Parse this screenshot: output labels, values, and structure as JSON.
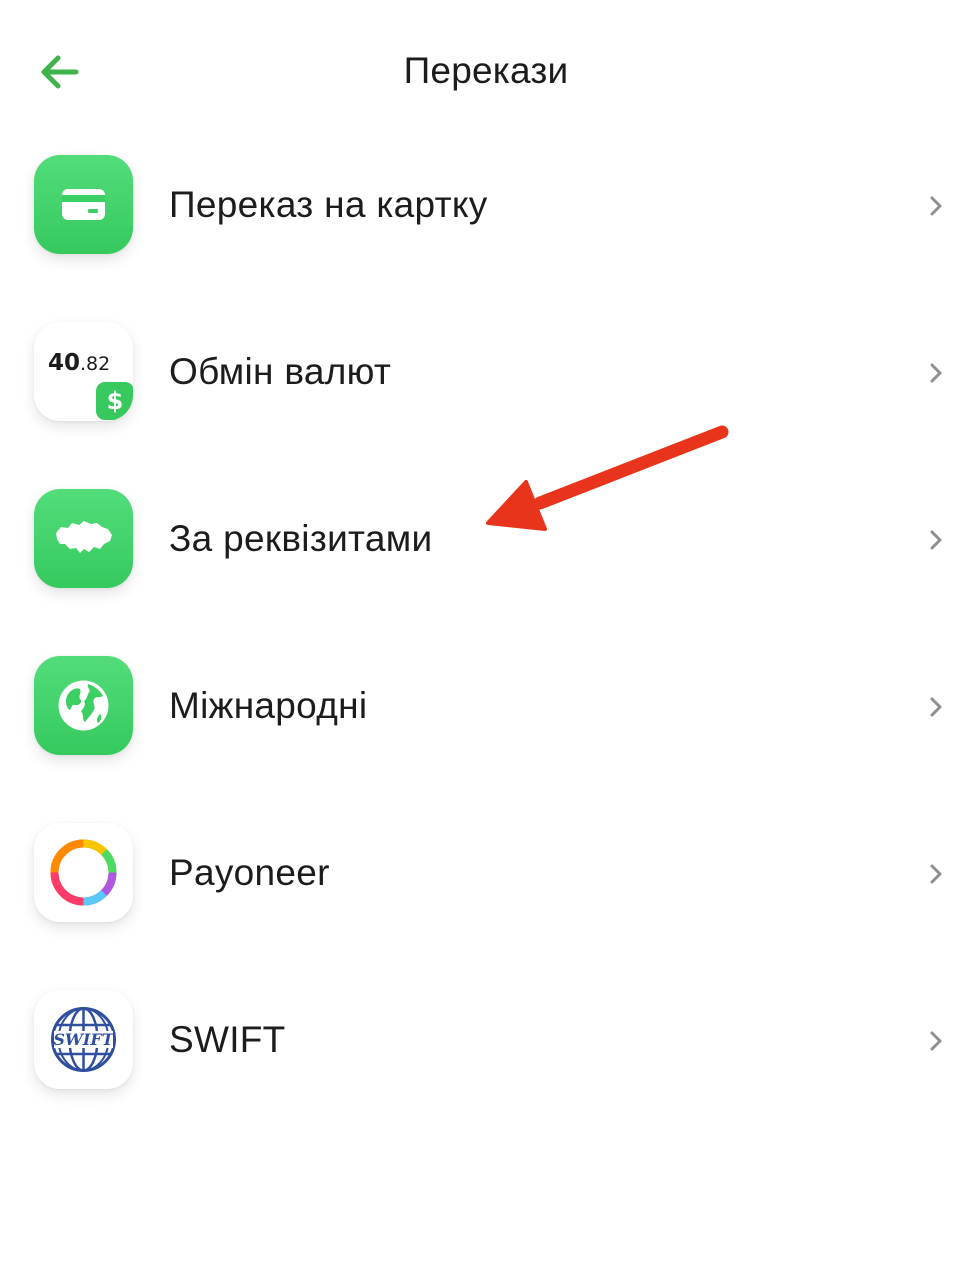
{
  "header": {
    "title": "Перекази",
    "back_icon": "arrow-left-icon"
  },
  "colors": {
    "accent_green": "#3fb34a",
    "tile_green": "#3ccf63",
    "annotation_red": "#e8341c",
    "chevron_gray": "#8e8e93"
  },
  "items": [
    {
      "label": "Переказ на картку",
      "icon": "card-icon"
    },
    {
      "label": "Обмін валют",
      "icon": "currency-exchange-icon",
      "rate_whole": "40",
      "rate_fraction": ".82",
      "badge": "$"
    },
    {
      "label": "За реквізитами",
      "icon": "ukraine-map-icon"
    },
    {
      "label": "Міжнародні",
      "icon": "globe-icon"
    },
    {
      "label": "Payoneer",
      "icon": "payoneer-ring-icon"
    },
    {
      "label": "SWIFT",
      "icon": "swift-globe-icon",
      "logo_text": "SWIFT"
    }
  ],
  "annotation": {
    "type": "arrow",
    "target": "За реквізитами",
    "color": "#e8341c"
  }
}
